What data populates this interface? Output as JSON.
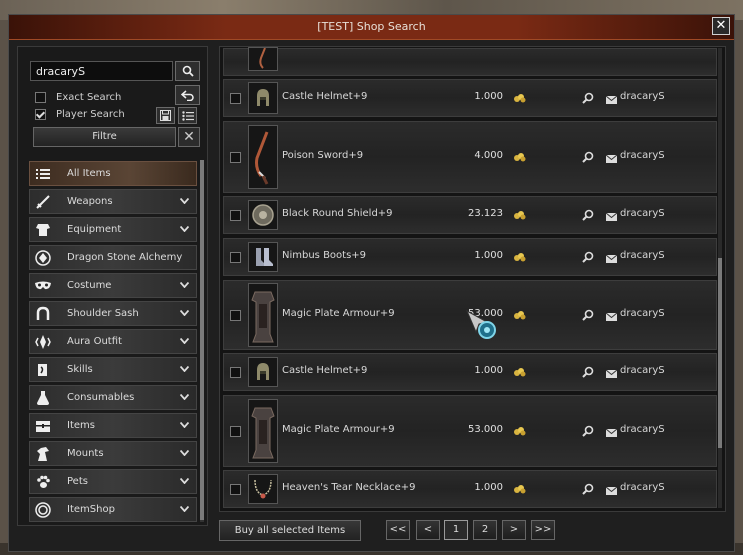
{
  "window": {
    "title": "[TEST] Shop Search"
  },
  "search": {
    "value": "dracaryS"
  },
  "options": {
    "exact_search": "Exact Search",
    "player_search": "Player Search",
    "exact_checked": false,
    "player_checked": true
  },
  "filter_label": "Filtre",
  "categories": [
    {
      "label": "All Items",
      "icon": "list-icon",
      "active": true,
      "expandable": false
    },
    {
      "label": "Weapons",
      "icon": "sword-icon",
      "expandable": true
    },
    {
      "label": "Equipment",
      "icon": "armor-icon",
      "expandable": true
    },
    {
      "label": "Dragon Stone Alchemy",
      "icon": "gem-icon",
      "expandable": false
    },
    {
      "label": "Costume",
      "icon": "mask-icon",
      "expandable": true
    },
    {
      "label": "Shoulder Sash",
      "icon": "sash-icon",
      "expandable": true
    },
    {
      "label": "Aura Outfit",
      "icon": "aura-icon",
      "expandable": true
    },
    {
      "label": "Skills",
      "icon": "book-icon",
      "expandable": true
    },
    {
      "label": "Consumables",
      "icon": "potion-icon",
      "expandable": true
    },
    {
      "label": "Items",
      "icon": "chest-icon",
      "expandable": true
    },
    {
      "label": "Mounts",
      "icon": "horse-icon",
      "expandable": true
    },
    {
      "label": "Pets",
      "icon": "paw-icon",
      "expandable": true
    },
    {
      "label": "ItemShop",
      "icon": "coin-icon",
      "expandable": true
    }
  ],
  "listings": [
    {
      "name": "Castle Helmet+9",
      "price": "1.000",
      "seller": "dracaryS",
      "icon": "helmet-icon"
    },
    {
      "name": "Poison Sword+9",
      "price": "4.000",
      "seller": "dracaryS",
      "icon": "sword-item-icon"
    },
    {
      "name": "Black Round Shield+9",
      "price": "23.123",
      "seller": "dracaryS",
      "icon": "shield-icon"
    },
    {
      "name": "Nimbus Boots+9",
      "price": "1.000",
      "seller": "dracaryS",
      "icon": "boots-icon"
    },
    {
      "name": "Magic Plate Armour+9",
      "price": "53.000",
      "seller": "dracaryS",
      "icon": "armour-icon"
    },
    {
      "name": "Castle Helmet+9",
      "price": "1.000",
      "seller": "dracaryS",
      "icon": "helmet-icon"
    },
    {
      "name": "Magic Plate Armour+9",
      "price": "53.000",
      "seller": "dracaryS",
      "icon": "armour-icon"
    },
    {
      "name": "Heaven's Tear Necklace+9",
      "price": "1.000",
      "seller": "dracaryS",
      "icon": "necklace-icon"
    }
  ],
  "footer": {
    "buy_label": "Buy all selected Items"
  },
  "pagination": {
    "first": "<<",
    "prev": "<",
    "pages": [
      "1",
      "2"
    ],
    "current": "1",
    "next": ">",
    "last": ">>"
  }
}
